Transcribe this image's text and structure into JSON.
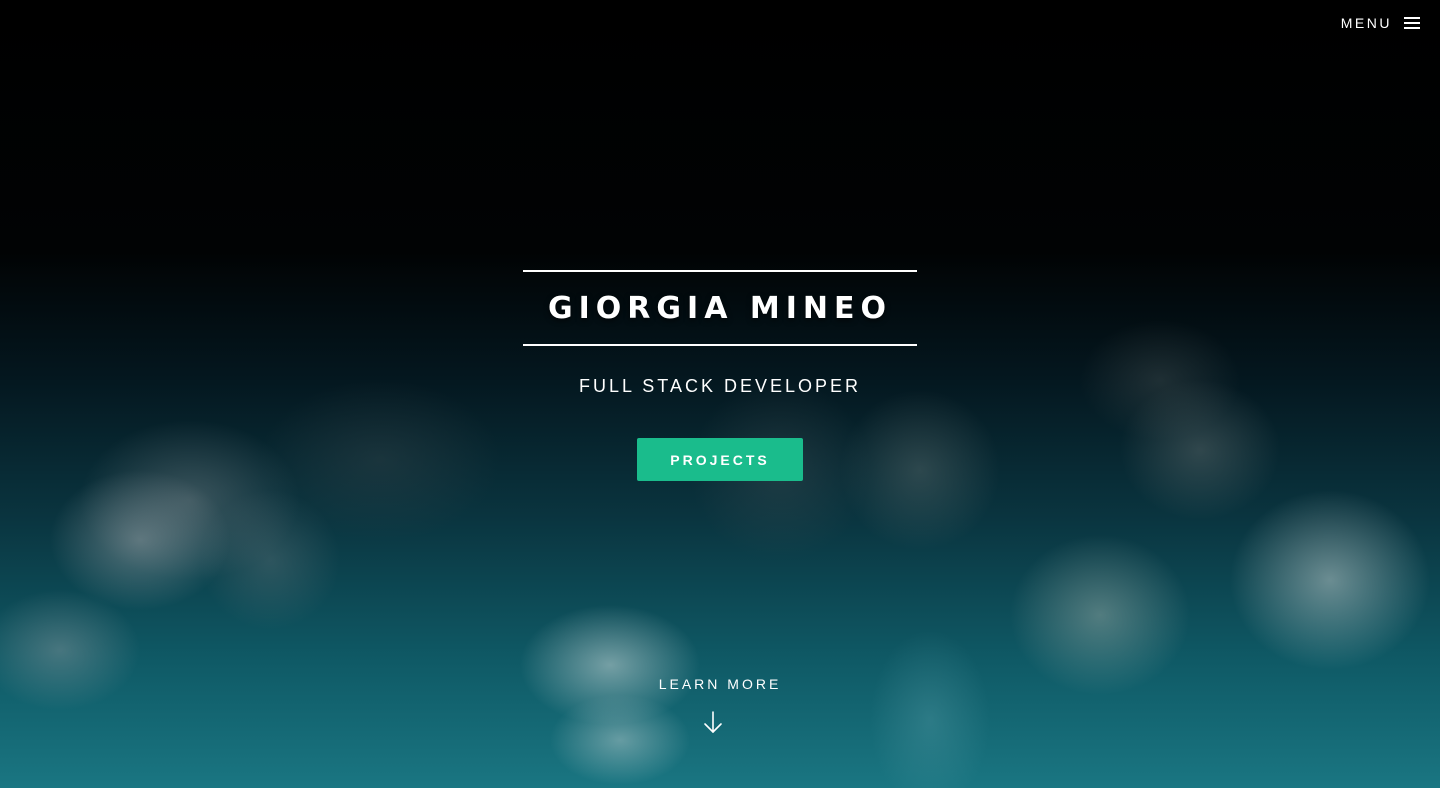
{
  "nav": {
    "menu_label": "MENU",
    "menu_icon": "hamburger-icon"
  },
  "hero": {
    "name": "GIORGIA MINEO",
    "role": "FULL STACK DEVELOPER",
    "cta_label": "PROJECTS",
    "learn_more_label": "LEARN MORE",
    "learn_more_icon": "arrow-down-icon"
  },
  "colors": {
    "accent": "#1abc8c",
    "text": "#ffffff",
    "background_top": "#000000",
    "background_bottom": "#1a7682"
  }
}
